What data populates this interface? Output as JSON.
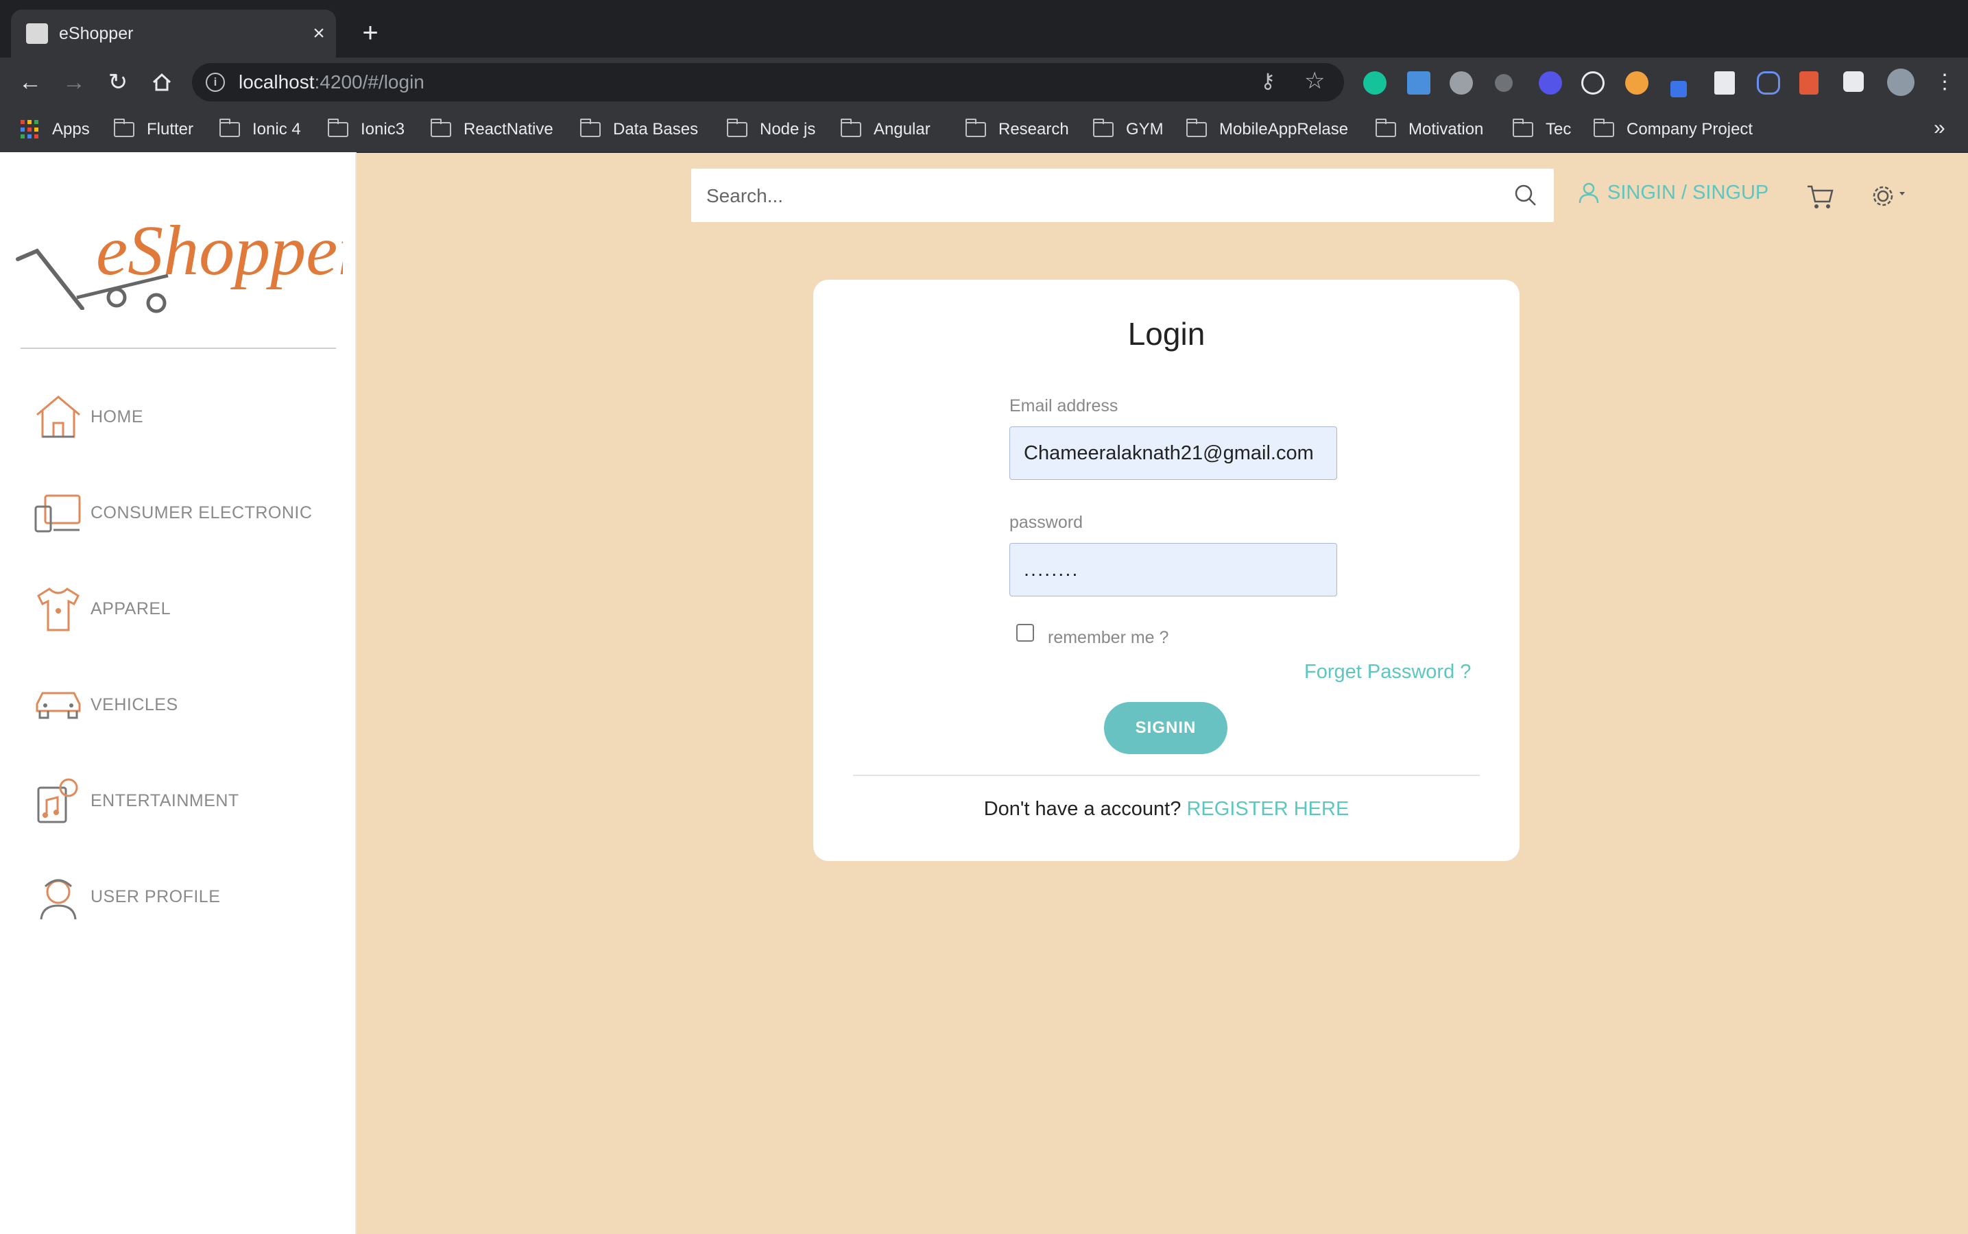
{
  "browser": {
    "tab_title": "eShopper",
    "tab_close": "×",
    "new_tab": "+",
    "url_host": "localhost",
    "url_path": ":4200/#/login",
    "bookmarks_more": "»",
    "bookmarks": [
      "Apps",
      "Flutter",
      "Ionic 4",
      "Ionic3",
      "ReactNative",
      "Data Bases",
      "Node js",
      "Angular",
      "Research",
      "GYM",
      "MobileAppRelase",
      "Motivation",
      "Tec",
      "Company Project"
    ]
  },
  "sidebar": {
    "logo_text": "eShopper",
    "items": [
      {
        "label": "HOME",
        "icon": "house-icon"
      },
      {
        "label": "CONSUMER ELECTRONIC",
        "icon": "devices-icon"
      },
      {
        "label": "APPAREL",
        "icon": "shirt-icon"
      },
      {
        "label": "VEHICLES",
        "icon": "car-icon"
      },
      {
        "label": "ENTERTAINMENT",
        "icon": "music-icon"
      },
      {
        "label": "USER PROFILE",
        "icon": "person-icon"
      }
    ]
  },
  "header": {
    "search_placeholder": "Search...",
    "signin_label": "SINGIN / SINGUP"
  },
  "login": {
    "title": "Login",
    "email_label": "Email address",
    "email_value": "Chameeralaknath21@gmail.com",
    "password_label": "password",
    "password_value": "........",
    "remember_label": "remember me ?",
    "forgot_label": "Forget Password ?",
    "signin_button": "SIGNIN",
    "no_account_text": "Don't have a account?",
    "register_label": "REGISTER HERE"
  },
  "colors": {
    "page_bg": "#f2d9b8",
    "accent": "#5cc6c0",
    "button": "#67c2c1",
    "icon_orange": "#e08a5a"
  }
}
